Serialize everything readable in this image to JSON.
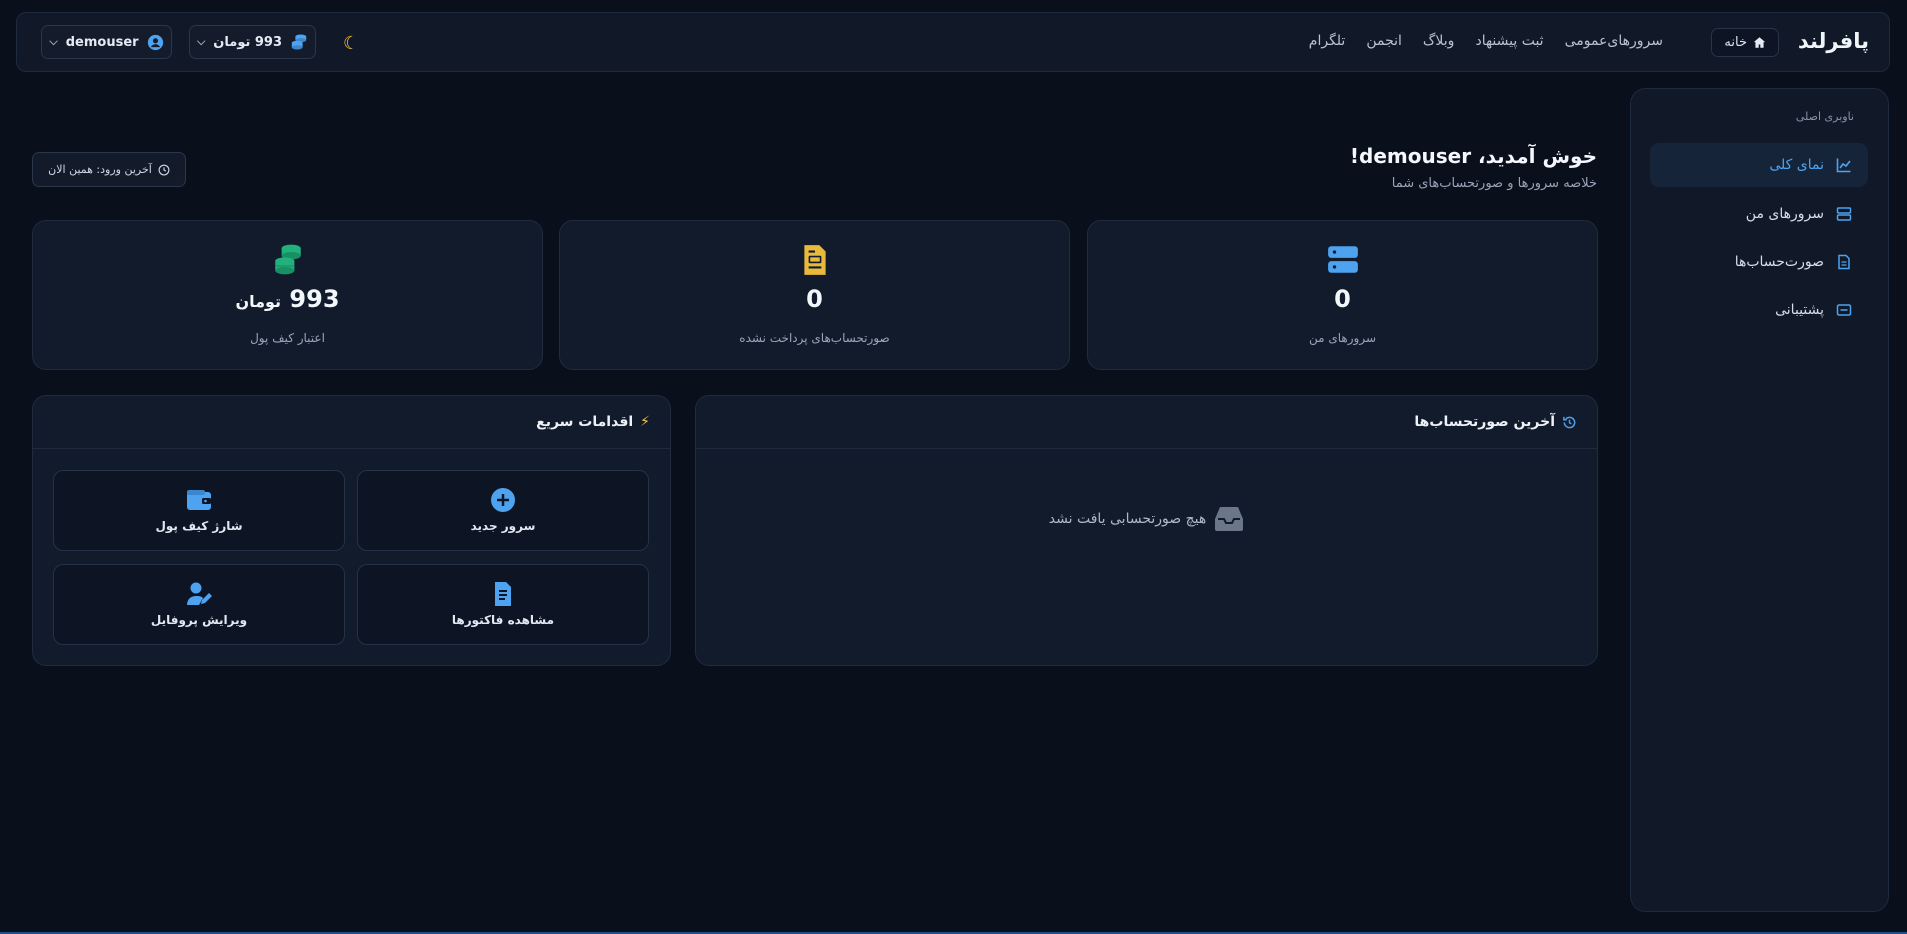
{
  "header": {
    "brand": "پافرلند",
    "home_label": "خانه",
    "nav": [
      "سرورهای‌عمومی",
      "ثبت پیشنهاد",
      "وبلاگ",
      "انجمن",
      "تلگرام"
    ],
    "balance_label": "993 تومان",
    "username": "demouser"
  },
  "sidebar": {
    "caption": "ناوبری اصلی",
    "items": [
      {
        "label": "نمای کلی",
        "icon": "chart-line-icon",
        "active": true
      },
      {
        "label": "سرورهای من",
        "icon": "server-icon",
        "active": false
      },
      {
        "label": "صورت‌حساب‌ها",
        "icon": "invoice-icon",
        "active": false
      },
      {
        "label": "پشتیبانی",
        "icon": "ticket-icon",
        "active": false
      }
    ]
  },
  "welcome": {
    "title": "خوش آمدید، demouser!",
    "subtitle": "خلاصه سرورها و صورتحساب‌های شما",
    "last_login": "آخرین ورود: همین الان"
  },
  "stats": {
    "servers": {
      "value": "0",
      "label": "سرورهای من"
    },
    "unpaid": {
      "value": "0",
      "label": "صورتحساب‌های پرداخت نشده"
    },
    "wallet": {
      "value": "993",
      "unit": "تومان",
      "label": "اعتبار کیف پول"
    }
  },
  "invoices_panel": {
    "title": "آخرین صورتحساب‌ها",
    "empty_text": "هیچ صورتحسابی یافت نشد"
  },
  "quick_actions": {
    "title": "اقدامات سریع",
    "items": {
      "new_server": "سرور جدید",
      "charge_wallet": "شارژ کیف پول",
      "view_invoices": "مشاهده فاکتورها",
      "edit_profile": "ویرایش پروفایل"
    }
  },
  "colors": {
    "accent": "#4ea3f0",
    "background": "#0a0f1c",
    "card": "#111b2b",
    "green": "#22b07d",
    "yellow": "#e8b93a"
  }
}
